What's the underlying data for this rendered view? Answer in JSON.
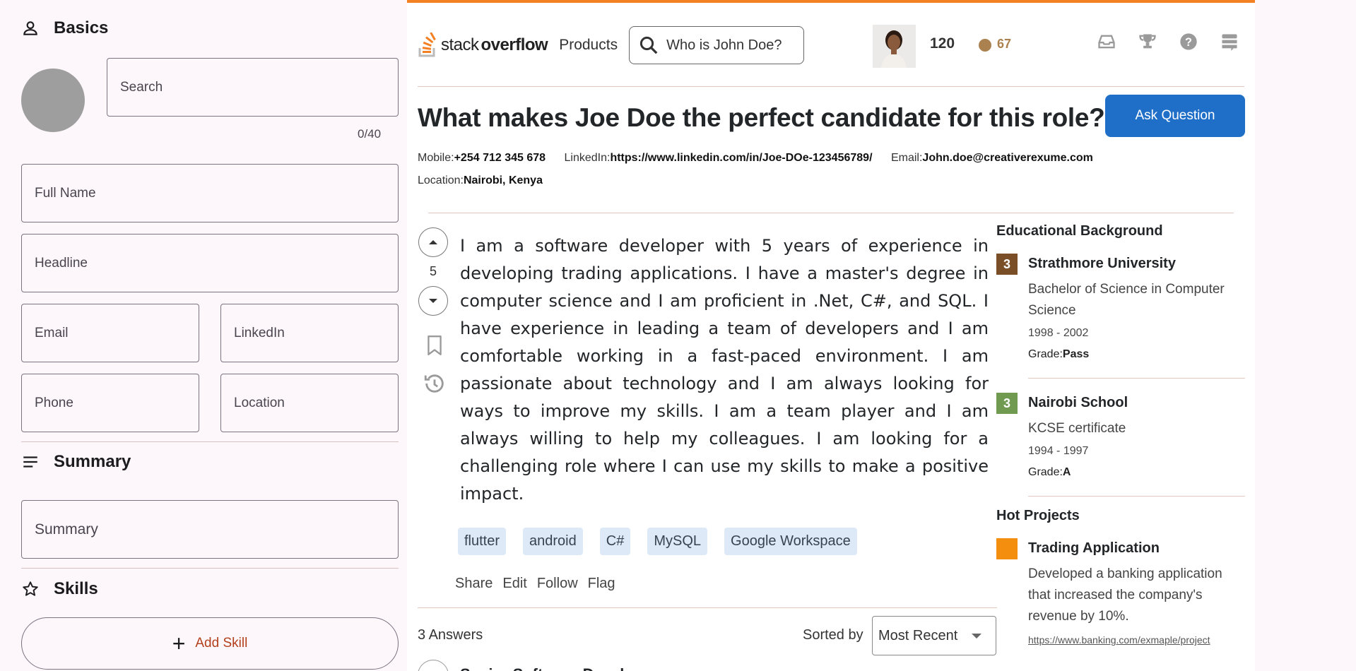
{
  "editor": {
    "basics": {
      "heading": "Basics",
      "search_placeholder": "Search",
      "char_counter": "0/40",
      "full_name_placeholder": "Full Name",
      "headline_placeholder": "Headline",
      "email_placeholder": "Email",
      "linkedin_placeholder": "LinkedIn",
      "phone_placeholder": "Phone",
      "location_placeholder": "Location"
    },
    "summary": {
      "heading": "Summary",
      "placeholder": "Summary"
    },
    "skills": {
      "heading": "Skills",
      "add_label": "Add Skill"
    }
  },
  "topbar": {
    "logo_light": "stack",
    "logo_bold": "overflow",
    "products_label": "Products",
    "search_value": "Who is John  Doe?",
    "reputation": "120",
    "bronze_count": "67",
    "icons": [
      "inbox-icon",
      "trophy-icon",
      "help-icon",
      "stack-exchange-icon"
    ]
  },
  "question": {
    "title": "What makes Joe Doe the perfect candidate for this role?",
    "ask_label": "Ask Question",
    "contact": {
      "mobile_label": "Mobile:",
      "mobile": "+254 712 345 678",
      "linkedin_label": "LinkedIn:",
      "linkedin": "https://www.linkedin.com/in/Joe-DOe-123456789/",
      "email_label": "Email:",
      "email": "John.doe@creativerexume.com",
      "location_label": "Location:",
      "location": "Nairobi, Kenya"
    },
    "votes": "5",
    "body": "I am a software developer with 5 years of experience in developing trading applications. I have a master's degree in computer science and I am proficient in .Net, C#, and SQL. I have experience in leading a team of developers and I am comfortable working in a fast-paced environment. I am passionate about technology and I am always looking for ways to improve my skills. I am a team player and I am always willing to help my colleagues. I am looking for a challenging role where I can use my skills to make a positive impact.",
    "tags": [
      "flutter",
      "android",
      "C#",
      "MySQL",
      "Google Workspace"
    ],
    "actions": {
      "share": "Share",
      "edit": "Edit",
      "follow": "Follow",
      "flag": "Flag"
    },
    "answers_count": "3 Answers",
    "sorted_by_label": "Sorted by",
    "sort_value": "Most Recent",
    "next_answer_partial": "Senior Software Developer"
  },
  "sidebar": {
    "education_heading": "Educational Background",
    "education": [
      {
        "badge": "3",
        "badge_color": "#7a4f28",
        "school": "Strathmore University",
        "degree": "Bachelor of Science in Computer Science",
        "years": "1998 - 2002",
        "grade_label": "Grade:",
        "grade": "Pass"
      },
      {
        "badge": "3",
        "badge_color": "#6f9a4f",
        "school": "Nairobi School",
        "degree": "KCSE certificate",
        "years": "1994 - 1997",
        "grade_label": "Grade:",
        "grade": "A"
      }
    ],
    "projects_heading": "Hot Projects",
    "projects": [
      {
        "name": "Trading Application",
        "color": "#f48e0f",
        "description": "Developed a banking application that increased the company's revenue by 10%.",
        "link": "https://www.banking.com/exmaple/project"
      }
    ]
  },
  "colors": {
    "accent_orange": "#f48024",
    "button_blue": "#1f6fc9",
    "tag_bg": "#dde9f7",
    "add_skill_text": "#b3401c"
  }
}
